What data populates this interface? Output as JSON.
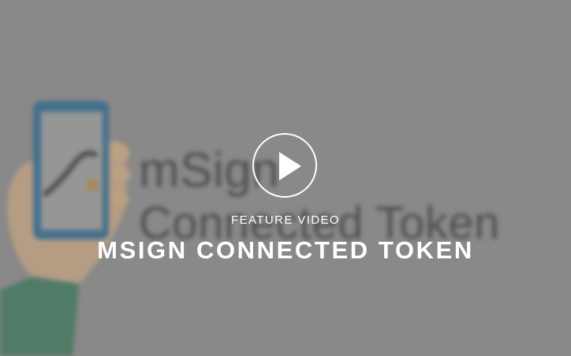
{
  "video_card": {
    "kicker": "FEATURE VIDEO",
    "title": "MSIGN CONNECTED TOKEN",
    "play_icon": "play-icon",
    "accent_color": "#ffffff",
    "background_color": "#8b8b8b"
  },
  "thumbnail": {
    "brand_text": "mSign",
    "sub_text": "Connected Token",
    "phone_color": "#3d6f8f",
    "hand_color": "#c9a884",
    "sleeve_color": "#3f7a5e"
  }
}
